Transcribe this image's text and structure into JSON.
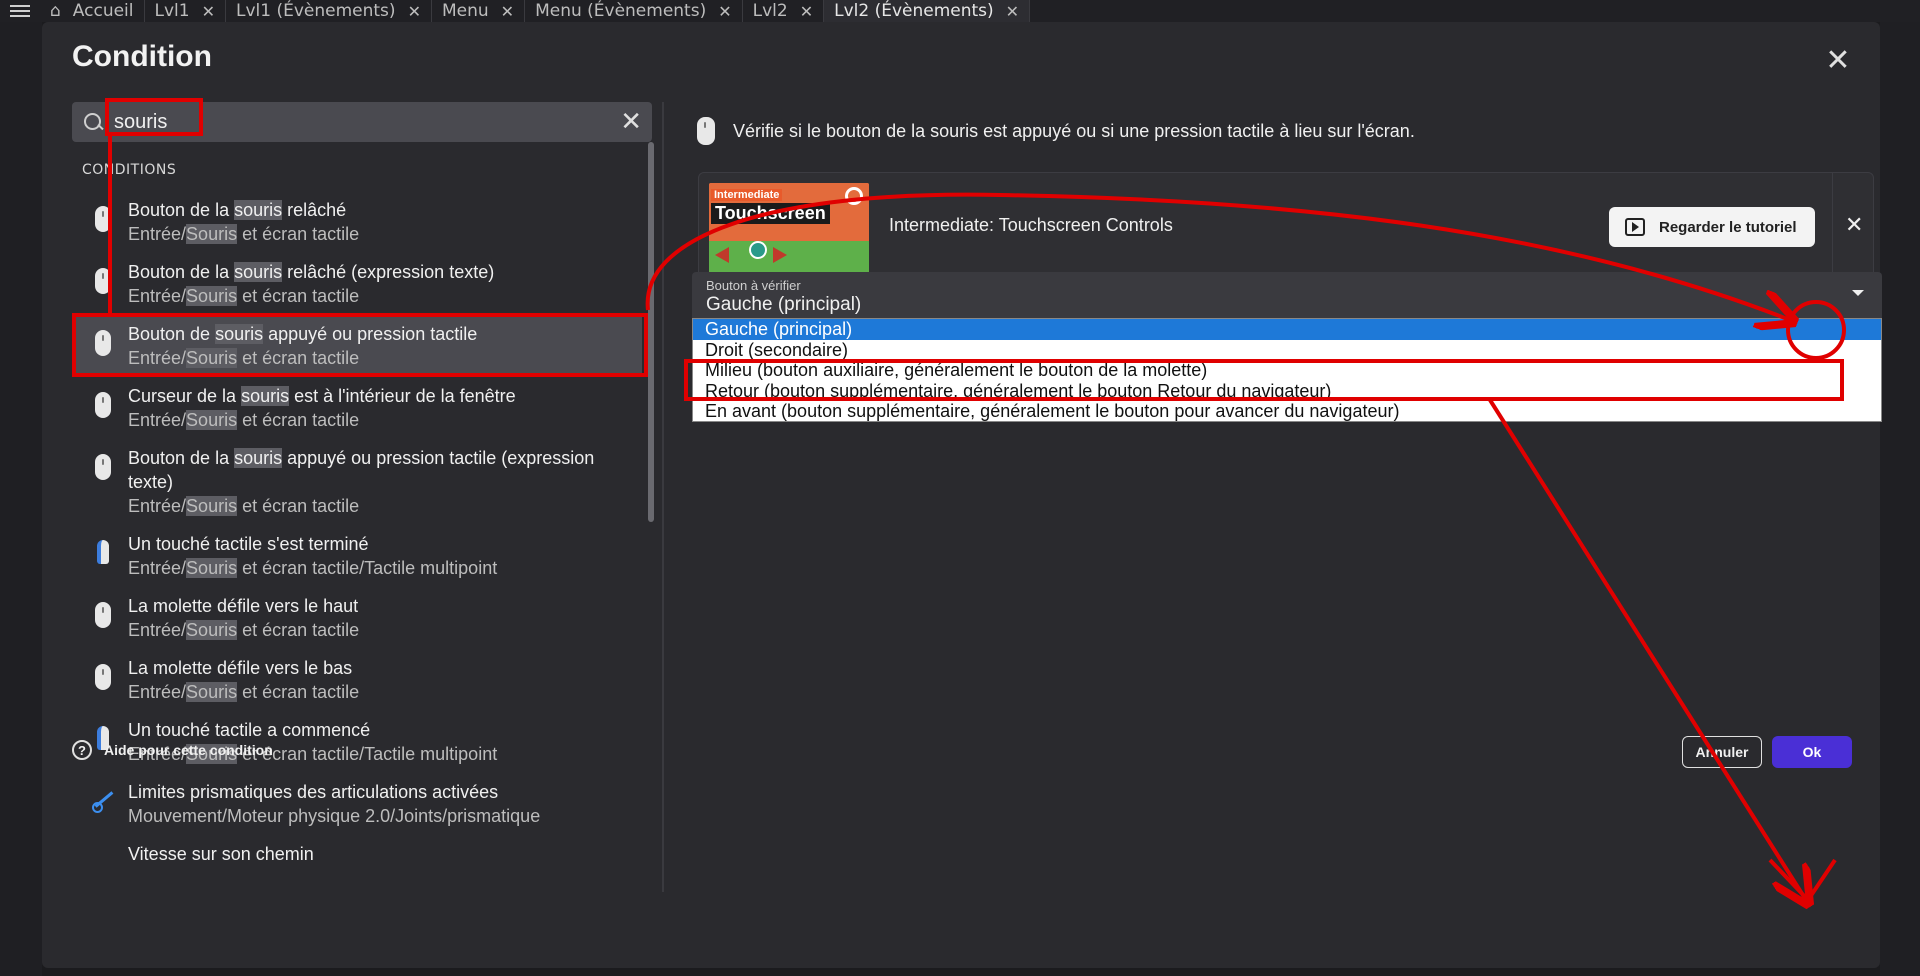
{
  "tabs": [
    {
      "label": "Accueil",
      "home": true
    },
    {
      "label": "Lvl1"
    },
    {
      "label": "Lvl1 (Évènements)"
    },
    {
      "label": "Menu"
    },
    {
      "label": "Menu (Évènements)"
    },
    {
      "label": "Lvl2"
    },
    {
      "label": "Lvl2 (Évènements)",
      "active": true
    }
  ],
  "dialog": {
    "title": "Condition",
    "search": {
      "value": "souris",
      "placeholder": ""
    },
    "section": "CONDITIONS",
    "items": [
      {
        "t1a": "Bouton de la ",
        "t1h": "souris",
        "t1b": " relâché",
        "t2a": "Entrée/",
        "t2h": "Souris",
        "t2b": " et écran tactile",
        "icon": "mouse-icon"
      },
      {
        "t1a": "Bouton de la ",
        "t1h": "souris",
        "t1b": " relâché (expression texte)",
        "t2a": "Entrée/",
        "t2h": "Souris",
        "t2b": " et écran tactile",
        "icon": "mouse-icon"
      },
      {
        "t1a": "Bouton de ",
        "t1h": "souris",
        "t1b": " appuyé ou pression tactile",
        "t2a": "Entrée/",
        "t2h": "Souris",
        "t2b": " et écran tactile",
        "icon": "mouse-icon",
        "selected": true
      },
      {
        "t1a": "Curseur de la ",
        "t1h": "souris",
        "t1b": " est à l'intérieur de la fenêtre",
        "t2a": "Entrée/",
        "t2h": "Souris",
        "t2b": " et écran tactile",
        "icon": "mouse-icon"
      },
      {
        "t1a": "Bouton de la ",
        "t1h": "souris",
        "t1b": " appuyé ou pression tactile (expression",
        "t1c": "texte)",
        "t2a": "Entrée/",
        "t2h": "Souris",
        "t2b": " et écran tactile",
        "icon": "mouse-icon"
      },
      {
        "t1a": "Un touché tactile s'est terminé",
        "t1h": "",
        "t1b": "",
        "t2a": "Entrée/",
        "t2h": "Souris",
        "t2b": " et écran tactile/Tactile multipoint",
        "icon": "touch-icon"
      },
      {
        "t1a": "La molette défile vers le haut",
        "t1h": "",
        "t1b": "",
        "t2a": "Entrée/",
        "t2h": "Souris",
        "t2b": " et écran tactile",
        "icon": "mouse-icon"
      },
      {
        "t1a": "La molette défile vers le bas",
        "t1h": "",
        "t1b": "",
        "t2a": "Entrée/",
        "t2h": "Souris",
        "t2b": " et écran tactile",
        "icon": "mouse-icon"
      },
      {
        "t1a": "Un touché tactile a commencé",
        "t1h": "",
        "t1b": "",
        "t2a": "Entrée/",
        "t2h": "Souris",
        "t2b": " et écran tactile/Tactile multipoint",
        "icon": "touch-icon"
      },
      {
        "t1a": "Limites prismatiques des articulations activées",
        "t1h": "",
        "t1b": "",
        "t2a": "Mouvement/Moteur physique 2.0/Joints/prismatique",
        "t2h": "",
        "t2b": "",
        "icon": "joint-icon"
      },
      {
        "t1a": "Vitesse sur son chemin",
        "t1h": "",
        "t1b": "",
        "t2a": "",
        "t2h": "",
        "t2b": "",
        "icon": "none"
      }
    ],
    "description": "Vérifie si le bouton de la souris est appuyé ou si une pression tactile à lieu sur l'écran.",
    "tutorial": {
      "thumb_chip1": "Intermediate",
      "thumb_chip2": "Touchscreen",
      "title": "Intermediate: Touchscreen Controls",
      "button": "Regarder le tutoriel"
    },
    "field": {
      "label": "Bouton à vérifier",
      "value": "Gauche (principal)",
      "options": [
        "Gauche (principal)",
        "Droit (secondaire)",
        "Milieu (bouton auxiliaire, généralement le bouton de la molette)",
        "Retour (bouton supplémentaire, généralement le bouton Retour du navigateur)",
        "En avant (bouton supplémentaire, généralement le bouton pour avancer du navigateur)"
      ],
      "selected_index": 0
    },
    "help": "Aide pour cette condition",
    "cancel": "Annuler",
    "ok": "Ok"
  },
  "colors": {
    "accent": "#4a2fd6",
    "selection": "#1e79d8",
    "annotation": "#e00000"
  }
}
